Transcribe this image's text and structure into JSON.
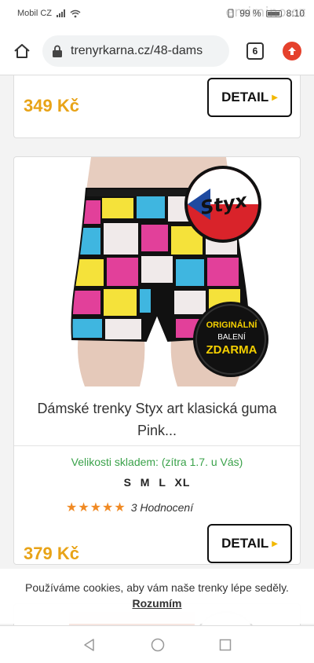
{
  "status": {
    "carrier": "Mobil CZ",
    "battery": "99 %",
    "time": "8:10",
    "watermark": "emimino.cz"
  },
  "browser": {
    "url": "trenyrkarna.cz/48-dams",
    "tab_count": "6"
  },
  "product_prev": {
    "price": "349 Kč",
    "detail_label": "DETAIL"
  },
  "product": {
    "badge_brand": "Styx",
    "badge_line1": "ORIGINÁLNÍ",
    "badge_line2": "BALENÍ",
    "badge_line3": "ZDARMA",
    "title": "Dámské trenky Styx art klasická guma Pink...",
    "stock": "Velikosti skladem: (zítra 1.7. u Vás)",
    "sizes": "S M L XL",
    "stars": "★★★★★",
    "rating_text": "3 Hodnocení",
    "price": "379 Kč",
    "detail_label": "DETAIL"
  },
  "cookie": {
    "message": "Používáme cookies, aby vám naše trenky lépe seděly.",
    "accept": "Rozumím"
  },
  "colors": {
    "price": "#e8a317",
    "stock": "#3aa24a",
    "stars": "#f08a24",
    "update": "#e5412c"
  }
}
